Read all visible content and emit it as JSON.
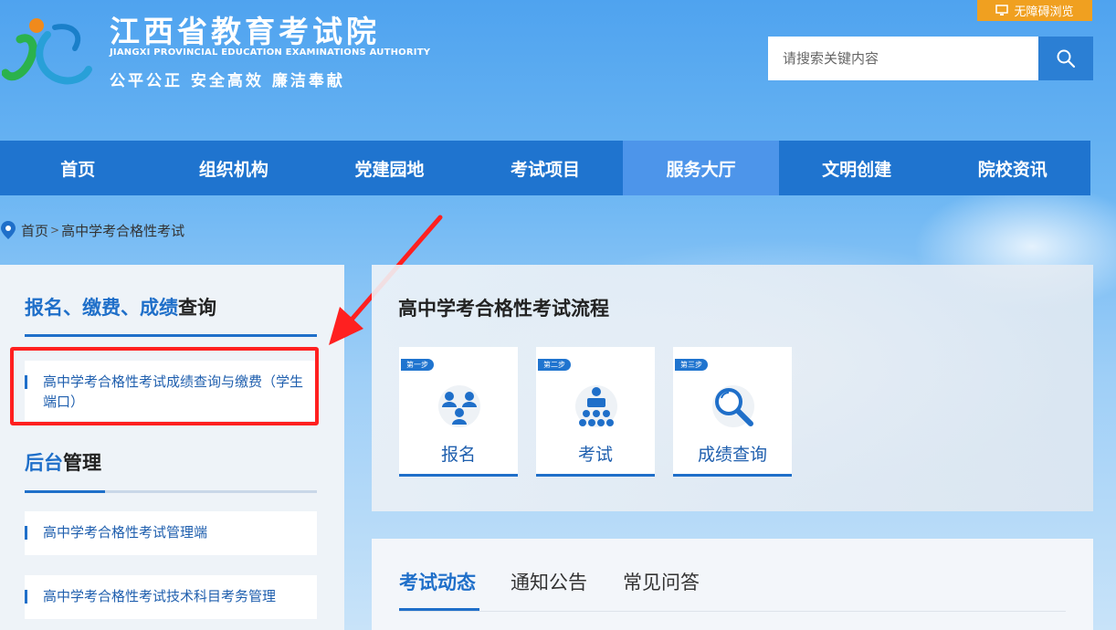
{
  "header": {
    "title": "江西省教育考试院",
    "en_title": "JIANGXI PROVINCIAL EDUCATION EXAMINATIONS AUTHORITY",
    "motto": "公平公正  安全高效  廉洁奉献",
    "accessibility_label": "无障碍浏览",
    "search_placeholder": "请搜索关键内容"
  },
  "nav": {
    "items": [
      {
        "label": "首页"
      },
      {
        "label": "组织机构"
      },
      {
        "label": "党建园地"
      },
      {
        "label": "考试项目"
      },
      {
        "label": "服务大厅",
        "active": true
      },
      {
        "label": "文明创建"
      },
      {
        "label": "院校资讯"
      }
    ]
  },
  "breadcrumb": {
    "home": "首页",
    "separator": ">",
    "current": "高中学考合格性考试"
  },
  "sidebar": {
    "section1_title_blue": "报名、缴费、成绩",
    "section1_title_rest": "查询",
    "section1_links": [
      {
        "label": "高中学考合格性考试成绩查询与缴费（学生端口）"
      }
    ],
    "section2_title_blue": "后台",
    "section2_title_rest": "管理",
    "section2_links": [
      {
        "label": "高中学考合格性考试管理端"
      },
      {
        "label": "高中学考合格性考试技术科目考务管理"
      }
    ]
  },
  "process": {
    "title": "高中学考合格性考试流程",
    "steps": [
      {
        "badge": "第一步",
        "label": "报名",
        "icon": "people-group-icon"
      },
      {
        "badge": "第二步",
        "label": "考试",
        "icon": "exam-hall-icon"
      },
      {
        "badge": "第三步",
        "label": "成绩查询",
        "icon": "magnifier-icon"
      }
    ]
  },
  "tabs": {
    "items": [
      {
        "label": "考试动态",
        "active": true
      },
      {
        "label": "通知公告"
      },
      {
        "label": "常见问答"
      }
    ]
  },
  "colors": {
    "nav_bg": "#1f74cf",
    "nav_active": "#4d95ea",
    "accent_blue": "#1f6fc9",
    "accessibility_orange": "#f0a020",
    "annotation_red": "#ff2020"
  }
}
